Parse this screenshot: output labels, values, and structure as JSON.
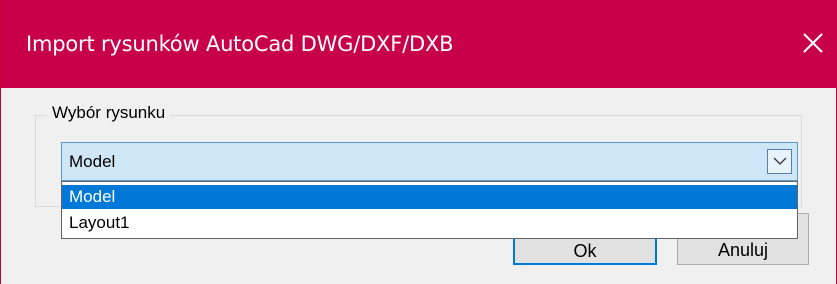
{
  "window": {
    "title": "Import rysunków AutoCad DWG/DXF/DXB",
    "close_icon": "close-icon",
    "accent_color": "#c8004a"
  },
  "group": {
    "label": "Wybór rysunku"
  },
  "combo": {
    "selected_value": "Model",
    "arrow_icon": "chevron-down-icon",
    "options": [
      {
        "label": "Model",
        "highlighted": true
      },
      {
        "label": "Layout1",
        "highlighted": false
      }
    ]
  },
  "buttons": {
    "ok_label": "Ok",
    "cancel_label": "Anuluj"
  }
}
